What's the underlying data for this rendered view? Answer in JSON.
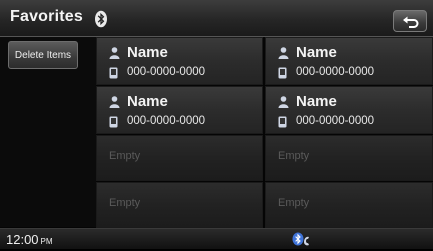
{
  "header": {
    "title": "Favorites",
    "bluetooth_icon": "bluetooth-icon",
    "back_icon": "back-arrow-icon"
  },
  "sidebar": {
    "delete_label": "Delete Items"
  },
  "favorites": [
    {
      "name": "Name",
      "phone": "000-0000-0000"
    },
    {
      "name": "Name",
      "phone": "000-0000-0000"
    },
    {
      "name": "Name",
      "phone": "000-0000-0000"
    },
    {
      "name": "Name",
      "phone": "000-0000-0000"
    },
    {
      "empty": "Empty"
    },
    {
      "empty": "Empty"
    },
    {
      "empty": "Empty"
    },
    {
      "empty": "Empty"
    }
  ],
  "status_bar": {
    "time": "12:00",
    "ampm": "PM",
    "connection_icon": "bluetooth-phone-icon"
  },
  "colors": {
    "accent_blue": "#3f73d8",
    "background": "#050505"
  }
}
